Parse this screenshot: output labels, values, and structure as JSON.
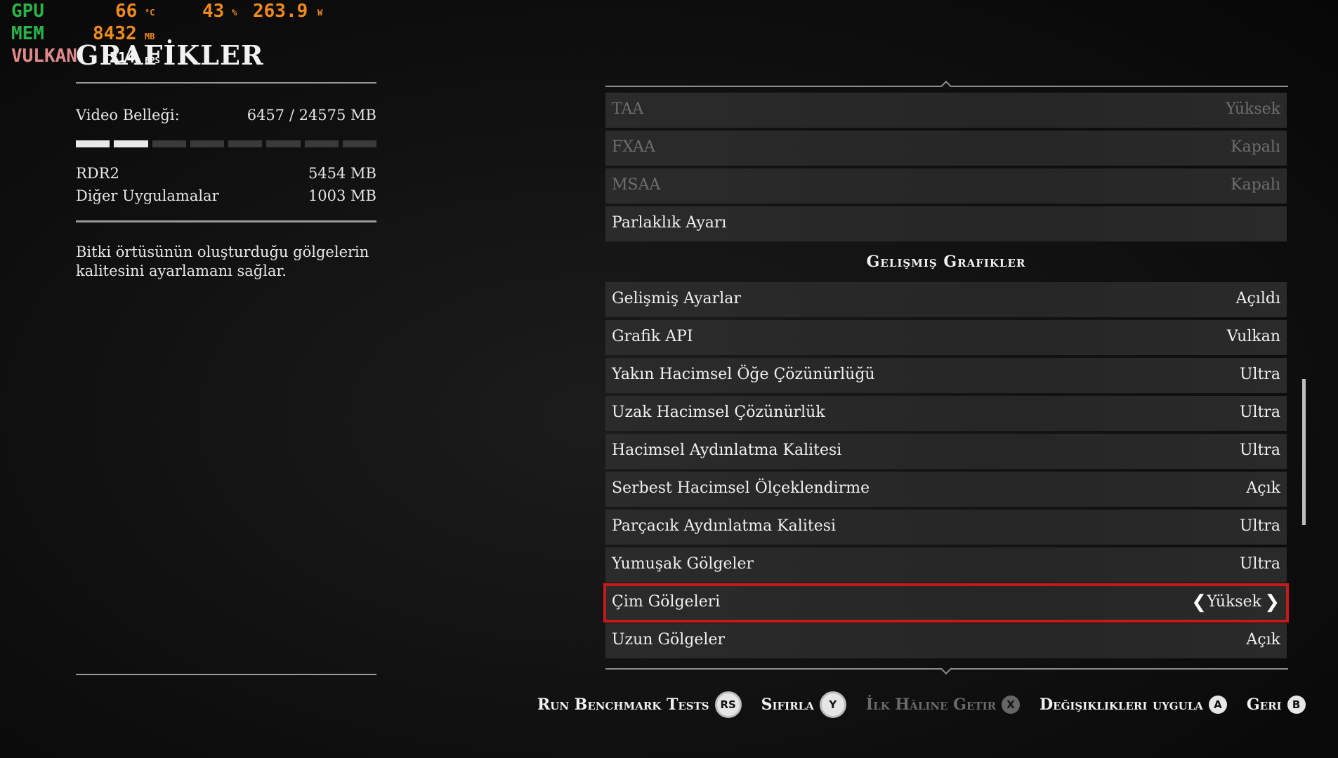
{
  "osd": {
    "gpu_label": "GPU",
    "gpu_temp": "66",
    "gpu_temp_unit": "°C",
    "gpu_load": "43",
    "gpu_load_unit": "%",
    "gpu_power": "263.9",
    "gpu_power_unit": "W",
    "mem_label": "MEM",
    "mem_value": "8432",
    "mem_unit": "MB",
    "api_label": "VULKAN",
    "fps_value": "214",
    "fps_unit": "FPS"
  },
  "left": {
    "title": "GRAFİKLER",
    "video_memory_label": "Video Belleği:",
    "video_memory_value": "6457  / 24575  MB",
    "memory_bar_fill": 0.26,
    "rdr2_label": "RDR2",
    "rdr2_value": "5454  MB",
    "other_label": "Diğer Uygulamalar",
    "other_value": "1003  MB",
    "description": "Bitki örtüsünün oluşturduğu gölgelerin kalitesini ayarlamanı sağlar."
  },
  "settings": {
    "rows_top": [
      {
        "name": "TAA",
        "value": "Yüksek",
        "dim": true
      },
      {
        "name": "FXAA",
        "value": "Kapalı",
        "dim": true
      },
      {
        "name": "MSAA",
        "value": "Kapalı",
        "dim": true
      },
      {
        "name": "Parlaklık Ayarı",
        "value": "",
        "dim": false
      }
    ],
    "section_title": "Gelişmiş Grafikler",
    "rows_advanced": [
      {
        "name": "Gelişmiş Ayarlar",
        "value": "Açıldı"
      },
      {
        "name": "Grafik API",
        "value": "Vulkan"
      },
      {
        "name": "Yakın Hacimsel Öğe Çözünürlüğü",
        "value": "Ultra"
      },
      {
        "name": "Uzak Hacimsel Çözünürlük",
        "value": "Ultra"
      },
      {
        "name": "Hacimsel Aydınlatma Kalitesi",
        "value": "Ultra"
      },
      {
        "name": "Serbest Hacimsel Ölçeklendirme",
        "value": "Açık"
      },
      {
        "name": "Parçacık Aydınlatma Kalitesi",
        "value": "Ultra"
      },
      {
        "name": "Yumuşak Gölgeler",
        "value": "Ultra"
      }
    ],
    "selected_row": {
      "name": "Çim Gölgeleri",
      "value": "Yüksek"
    },
    "last_row": {
      "name": "Uzun Gölgeler",
      "value": "Açık"
    }
  },
  "footer": {
    "benchmark_label": "Run Benchmark Tests",
    "benchmark_button": "RS",
    "reset_label": "Sıfırla",
    "reset_button": "Y",
    "restore_label": "İlk Hâline Getir",
    "restore_button": "X",
    "apply_label": "Değişiklikleri uygula",
    "apply_button": "A",
    "back_label": "Geri",
    "back_button": "B"
  },
  "colors": {
    "selection_outline": "#c41a1a",
    "osd_green": "#2bb34a",
    "osd_orange": "#f08a1e"
  }
}
